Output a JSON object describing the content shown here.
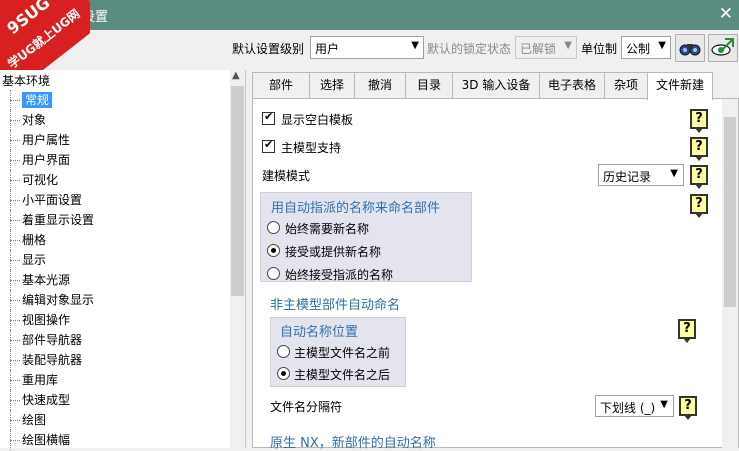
{
  "window": {
    "title": "设置",
    "close_glyph": "✕"
  },
  "watermark": {
    "logo": "9SUG",
    "text": "学UG就上UG网"
  },
  "toolbar": {
    "default_level_label": "默认设置级别",
    "default_level_value": "用户",
    "lock_state_label": "默认的锁定状态",
    "lock_state_value": "已解锁",
    "unit_label": "单位制",
    "unit_value": "公制"
  },
  "tree": {
    "root": "基本环境",
    "items": [
      "常规",
      "对象",
      "用户属性",
      "用户界面",
      "可视化",
      "小平面设置",
      "着重显示设置",
      "栅格",
      "显示",
      "基本光源",
      "编辑对象显示",
      "视图操作",
      "部件导航器",
      "装配导航器",
      "重用库",
      "快速成型",
      "绘图",
      "绘图横幅"
    ],
    "selected_index": 0
  },
  "tabs": [
    "部件",
    "选择",
    "撤消",
    "目录",
    "3D 输入设备",
    "电子表格",
    "杂项",
    "文件新建"
  ],
  "active_tab": 7,
  "content": {
    "show_blank_template": "显示空白模板",
    "master_model_support": "主模型支持",
    "modeling_mode_label": "建模模式",
    "modeling_mode_value": "历史记录",
    "auto_name_group": {
      "title": "用自动指派的名称来命名部件",
      "options": [
        "始终需要新名称",
        "接受或提供新名称",
        "始终接受指派的名称"
      ],
      "selected": 1
    },
    "non_master_title": "非主模型部件自动命名",
    "auto_position_group": {
      "title": "自动名称位置",
      "options": [
        "主模型文件名之前",
        "主模型文件名之后"
      ],
      "selected": 1
    },
    "separator_label": "文件名分隔符",
    "separator_value": "下划线 (_)",
    "native_nx_title": "原生 NX，新部件的自动名称"
  },
  "help_glyph": "?"
}
